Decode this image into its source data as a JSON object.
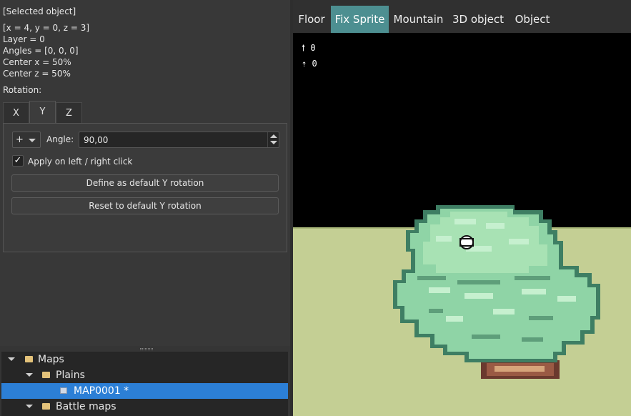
{
  "properties": {
    "header": "[Selected object]",
    "position": "[x = 4, y = 0, z = 3]",
    "layer": "Layer = 0",
    "angles": "Angles = [0, 0, 0]",
    "center_x": "Center x = 50%",
    "center_z": "Center z = 50%",
    "rotation_label": "Rotation:",
    "axis_tabs": [
      "X",
      "Y",
      "Z"
    ],
    "active_axis_tab": "Y",
    "sign_combo": "+",
    "angle_label": "Angle:",
    "angle_value": "90,00",
    "apply_checkbox_checked": true,
    "apply_label": "Apply on left / right click",
    "define_default_button": "Define as default Y rotation",
    "reset_default_button": "Reset to default Y rotation"
  },
  "tree": {
    "items": [
      {
        "label": "Maps",
        "type": "folder",
        "expanded": true,
        "level": 0
      },
      {
        "label": "Plains",
        "type": "folder",
        "expanded": true,
        "level": 1
      },
      {
        "label": "MAP0001 *",
        "type": "map",
        "selected": true,
        "level": 2
      },
      {
        "label": "Battle maps",
        "type": "folder",
        "expanded": true,
        "level": 1
      }
    ]
  },
  "editor": {
    "tabs": [
      "Floor",
      "Fix Sprite",
      "Mountain",
      "3D object",
      "Object"
    ],
    "active_tab": "Fix Sprite",
    "hud": {
      "up_value": "0",
      "up_plus_value": "0"
    },
    "colors": {
      "active_tab": "#4d8f91",
      "ground": "#c4cf94",
      "bush_light": "#a8e2b4",
      "bush_mid": "#8fd4a6",
      "bush_dark": "#5e9e7a",
      "trunk": "#8a4b3a",
      "selection": "#2c7fd6"
    }
  }
}
